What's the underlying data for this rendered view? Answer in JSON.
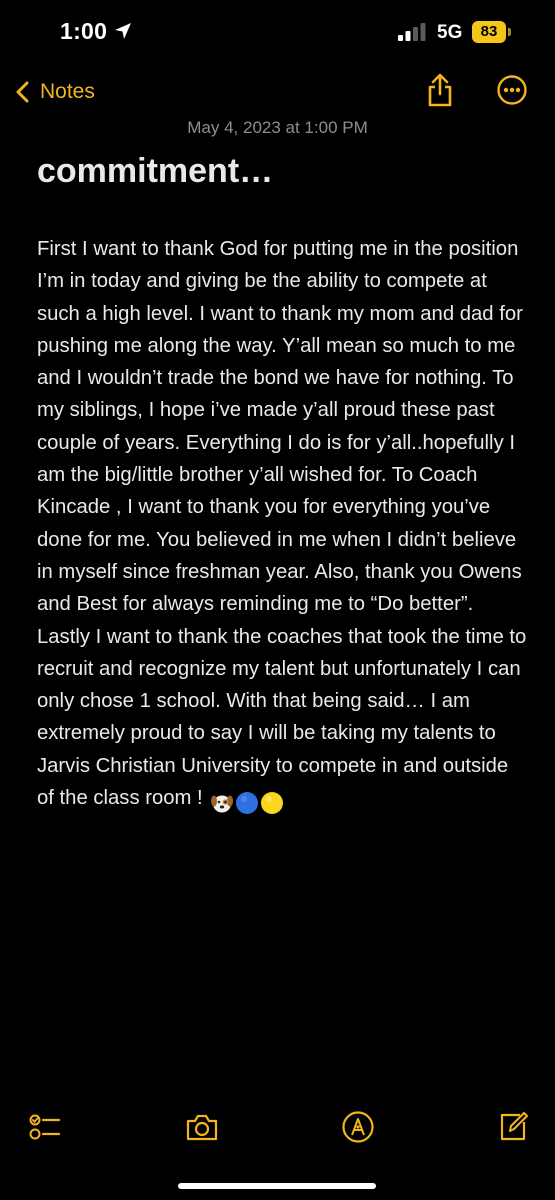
{
  "status_bar": {
    "time": "1:00",
    "network": "5G",
    "battery": "83"
  },
  "nav": {
    "back_label": "Notes"
  },
  "note": {
    "date": "May 4, 2023 at 1:00 PM",
    "title": "commitment…",
    "body": "First I want to thank God for putting me in the position I’m in today and giving be the ability to compete at such a high level. I want to thank my mom and dad for pushing me along the way. Y’all mean so much to me and I wouldn’t trade the bond we have for nothing. To my siblings, I hope i’ve made y’all proud these past couple of years. Everything I do is  for y’all..hopefully I am the big/little brother y’all wished for. To Coach Kincade , I want to thank you for everything you’ve done for me. You believed in me when I didn’t believe in myself since freshman year. Also, thank you Owens and Best for always reminding me to “Do better”. Lastly I want to thank the coaches that took the time to recruit and recognize my talent but unfortunately I can only chose 1 school. With that being said… I am extremely proud to say I will be taking my talents to Jarvis Christian University to compete in and outside of the class room !",
    "emojis": [
      "dog-face",
      "blue-circle",
      "yellow-circle"
    ]
  },
  "colors": {
    "accent": "#f2b51f",
    "background": "#000000",
    "text": "#e9e9e9",
    "date_text": "#8d8d93"
  }
}
